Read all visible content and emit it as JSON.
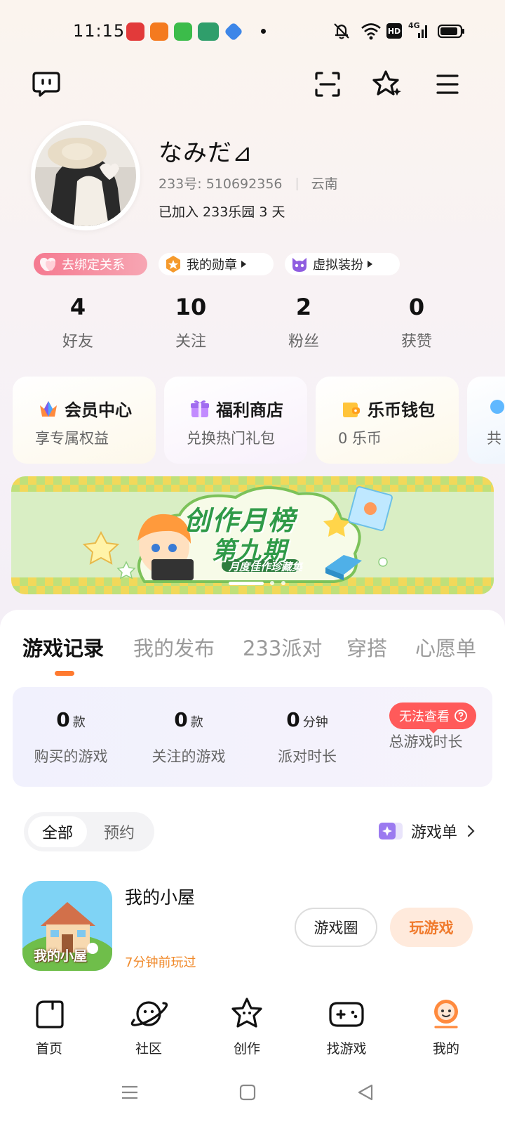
{
  "status_bar": {
    "time": "11:15",
    "hd_label": "HD",
    "net_label": "4G",
    "app_icon_colors": [
      "#e23a3a",
      "#f47a1f",
      "#3cbc4a",
      "#2f9e6b",
      "#3d86e8"
    ]
  },
  "header": {
    "icons": [
      "chat-bubble-icon",
      "scan-icon",
      "star-sparkle-icon",
      "menu-icon"
    ]
  },
  "profile": {
    "nickname": "なみだ⊿",
    "id_label": "233号: 510692356",
    "region": "云南",
    "joined": "已加入 233乐园 3 天"
  },
  "chips": {
    "relation": "去绑定关系",
    "badges": "我的勋章",
    "dressup": "虚拟装扮"
  },
  "stats": [
    {
      "num": "4",
      "label": "好友"
    },
    {
      "num": "10",
      "label": "关注"
    },
    {
      "num": "2",
      "label": "粉丝"
    },
    {
      "num": "0",
      "label": "获赞"
    }
  ],
  "cards": [
    {
      "title": "会员中心",
      "sub": "享专属权益"
    },
    {
      "title": "福利商店",
      "sub": "兑换热门礼包"
    },
    {
      "title": "乐币钱包",
      "sub": "0 乐币"
    },
    {
      "title": "",
      "sub": "共"
    }
  ],
  "banner": {
    "line1": "创作月榜",
    "line2": "第九期",
    "line3": "月度佳作珍藏集"
  },
  "tabs": [
    "游戏记录",
    "我的发布",
    "233派对",
    "穿搭",
    "心愿单"
  ],
  "records": [
    {
      "num": "0",
      "unit": "款",
      "label": "购买的游戏"
    },
    {
      "num": "0",
      "unit": "款",
      "label": "关注的游戏"
    },
    {
      "num": "0",
      "unit": "分钟",
      "label": "派对时长"
    },
    {
      "num": "",
      "unit": "",
      "label": "总游戏时长"
    }
  ],
  "warn_tag": "无法查看",
  "segment": {
    "all": "全部",
    "reserve": "预约"
  },
  "game_list_link": "游戏单",
  "game": {
    "title": "我的小屋",
    "icon_text": "我的小屋",
    "played": "7分钟前玩过",
    "circle_btn": "游戏圈",
    "play_btn": "玩游戏"
  },
  "nav": [
    "首页",
    "社区",
    "创作",
    "找游戏",
    "我的"
  ],
  "colors": {
    "accent": "#ff7a2f",
    "warn": "#ff5a5a",
    "play_btn_bg": "#ffeadc",
    "play_btn_text": "#f07a2c"
  }
}
